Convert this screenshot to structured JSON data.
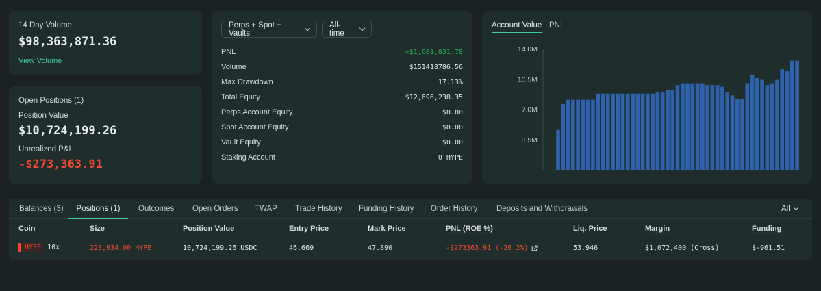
{
  "volume_card": {
    "label": "14 Day Volume",
    "value": "$98,363,871.36",
    "link": "View Volume"
  },
  "positions_card": {
    "title": "Open Positions (1)",
    "position_value_label": "Position Value",
    "position_value": "$10,724,199.26",
    "unrealized_label": "Unrealized P&L",
    "unrealized_value": "-$273,363.91"
  },
  "stats": {
    "filter_scope": "Perps + Spot + Vaults",
    "filter_time": "All-time",
    "rows": [
      {
        "label": "PNL",
        "value": "+$1,601,831.78"
      },
      {
        "label": "Volume",
        "value": "$151418786.56"
      },
      {
        "label": "Max Drawdown",
        "value": "17.13%"
      },
      {
        "label": "Total Equity",
        "value": "$12,696,238.35"
      },
      {
        "label": "Perps Account Equity",
        "value": "$0.00"
      },
      {
        "label": "Spot Account Equity",
        "value": "$0.00"
      },
      {
        "label": "Vault Equity",
        "value": "$0.00"
      },
      {
        "label": "Staking Account",
        "value": "0 HYPE"
      }
    ],
    "colors": {
      "pnl_positive": "#25b24d"
    }
  },
  "chart_tabs": {
    "active": "Account Value",
    "inactive": "PNL"
  },
  "chart_data": {
    "type": "bar",
    "title": "",
    "xlabel": "",
    "ylabel": "",
    "ylim": [
      0,
      14.0
    ],
    "unit": "M",
    "yticks": [
      "14.0M",
      "10.5M",
      "7.0M",
      "3.5M"
    ],
    "ytick_values": [
      14.0,
      10.5,
      7.0,
      3.5
    ],
    "bar_color": "#2e62ad",
    "values": [
      4.6,
      7.6,
      8.1,
      8.1,
      8.1,
      8.1,
      8.1,
      8.1,
      8.8,
      8.8,
      8.8,
      8.8,
      8.8,
      8.8,
      8.8,
      8.8,
      8.8,
      8.8,
      8.8,
      8.8,
      9.0,
      9.0,
      9.2,
      9.2,
      9.8,
      10.0,
      10.0,
      10.0,
      10.0,
      10.0,
      9.8,
      9.8,
      9.8,
      9.6,
      9.0,
      8.6,
      8.2,
      8.2,
      10.0,
      11.0,
      10.6,
      10.4,
      9.8,
      10.0,
      10.4,
      11.6,
      11.4,
      12.6,
      12.6
    ],
    "grid": false,
    "legend": "none"
  },
  "tabs": {
    "items": [
      "Balances (3)",
      "Positions (1)",
      "Outcomes",
      "Open Orders",
      "TWAP",
      "Trade History",
      "Funding History",
      "Order History",
      "Deposits and Withdrawals"
    ],
    "active_index": 1,
    "filter_label": "All"
  },
  "table": {
    "headers": [
      "Coin",
      "Size",
      "Position Value",
      "Entry Price",
      "Mark Price",
      "PNL (ROE %)",
      "Liq. Price",
      "Margin",
      "Funding"
    ],
    "row": {
      "coin": "HYPE",
      "leverage": "10x",
      "size": "223,934.00 HYPE",
      "position_value": "10,724,199.26 USDC",
      "entry_price": "46.669",
      "mark_price": "47.890",
      "pnl": "-$273363.91 (-26.2%)",
      "liq_price": "53.946",
      "margin": "$1,072,400 (Cross)",
      "funding": "$-961.51"
    }
  }
}
